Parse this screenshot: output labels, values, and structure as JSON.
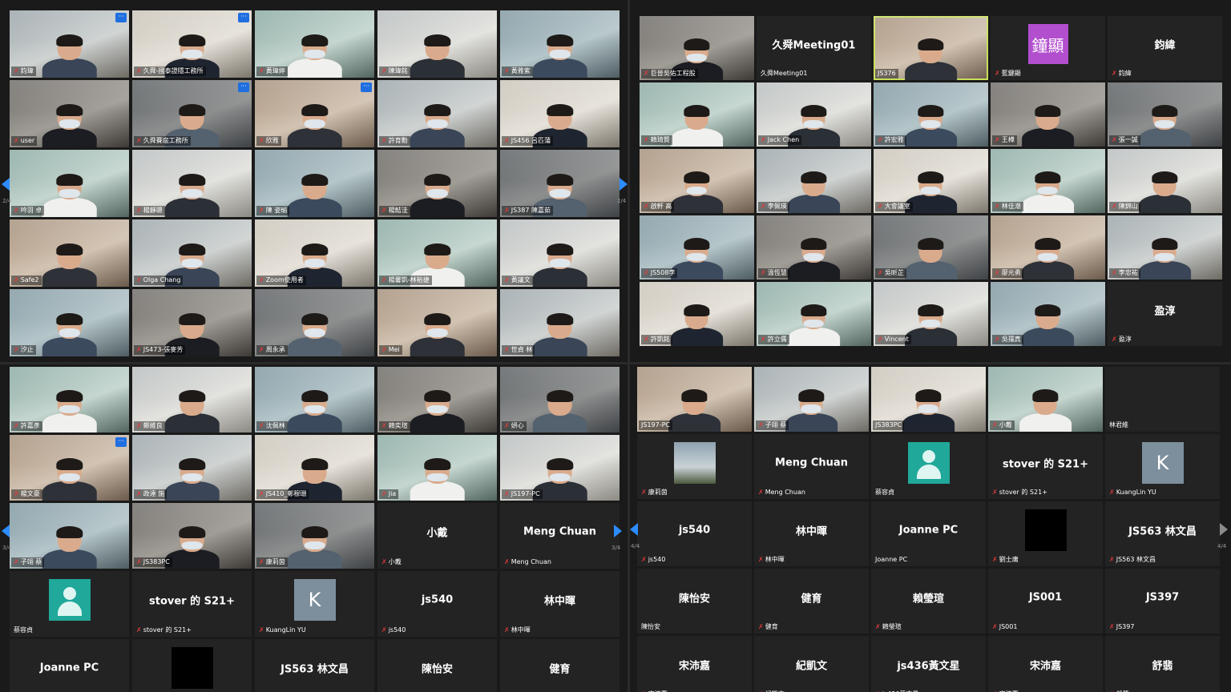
{
  "quadrants": [
    {
      "id": "top-left",
      "page": "2/4",
      "tiles": [
        {
          "name": "鈞瑋",
          "kind": "video",
          "more": true
        },
        {
          "name": "久舜-國泰證隱工務所",
          "kind": "video",
          "more": true
        },
        {
          "name": "黃瑋婷",
          "kind": "video"
        },
        {
          "name": "陳瑋銘",
          "kind": "video"
        },
        {
          "name": "黃雅紫",
          "kind": "video"
        },
        {
          "name": "user",
          "kind": "video"
        },
        {
          "name": "久舜賽扆工務所",
          "kind": "video",
          "more": true
        },
        {
          "name": "欣雅",
          "kind": "video",
          "more": true
        },
        {
          "name": "許育勳",
          "kind": "video"
        },
        {
          "name": "JS456 呂匹蒲",
          "kind": "video"
        },
        {
          "name": "吟羽 卓",
          "kind": "video"
        },
        {
          "name": "楊靜聰",
          "kind": "video"
        },
        {
          "name": "陳 姿瑜",
          "kind": "video"
        },
        {
          "name": "楊鮚洼",
          "kind": "video"
        },
        {
          "name": "JS387 陳嘉茹",
          "kind": "video"
        },
        {
          "name": "Safe2",
          "kind": "video"
        },
        {
          "name": "Olga Chang",
          "kind": "video"
        },
        {
          "name": "Zoom使用者",
          "kind": "video"
        },
        {
          "name": "楊馨凱-林裕捷",
          "kind": "video"
        },
        {
          "name": "黃議文",
          "kind": "video"
        },
        {
          "name": "汐止",
          "kind": "video"
        },
        {
          "name": "JS473-張麥芳",
          "kind": "video"
        },
        {
          "name": "周永承",
          "kind": "video"
        },
        {
          "name": "Mei",
          "kind": "video"
        },
        {
          "name": "世貞 林",
          "kind": "video"
        }
      ]
    },
    {
      "id": "top-right",
      "page": "",
      "tiles": [
        {
          "name": "巨晉吳佑工程股",
          "kind": "video"
        },
        {
          "name": "久舜Meeting01",
          "kind": "name",
          "big": "久舜Meeting01",
          "nomic": true
        },
        {
          "name": "JS376",
          "kind": "video",
          "speaking": true,
          "nomic": true
        },
        {
          "name": "藍鍵顯",
          "kind": "avatar-purple",
          "big": "鐘顯"
        },
        {
          "name": "鈞緯",
          "kind": "name",
          "big": "鈞緯"
        },
        {
          "name": "賴琦賢",
          "kind": "video"
        },
        {
          "name": "Jack Chen",
          "kind": "video"
        },
        {
          "name": "許宏雅",
          "kind": "video"
        },
        {
          "name": "王樺",
          "kind": "video"
        },
        {
          "name": "張一誠",
          "kind": "video"
        },
        {
          "name": "啟軒 高",
          "kind": "video"
        },
        {
          "name": "李佩瑛",
          "kind": "video"
        },
        {
          "name": "大會議室",
          "kind": "video"
        },
        {
          "name": "林佳潮",
          "kind": "video"
        },
        {
          "name": "陳錦山",
          "kind": "video"
        },
        {
          "name": "JS508李",
          "kind": "video"
        },
        {
          "name": "溫恆慧",
          "kind": "video"
        },
        {
          "name": "吳昕芷",
          "kind": "video"
        },
        {
          "name": "廖元勇",
          "kind": "video"
        },
        {
          "name": "李忠祐",
          "kind": "video"
        },
        {
          "name": "許凱銘",
          "kind": "video"
        },
        {
          "name": "許立儒",
          "kind": "video"
        },
        {
          "name": "Vincent",
          "kind": "video"
        },
        {
          "name": "吳孺真",
          "kind": "video"
        },
        {
          "name": "盈淳",
          "kind": "name",
          "big": "盈淳"
        }
      ]
    },
    {
      "id": "bottom-left",
      "page": "3/4",
      "tiles": [
        {
          "name": "許嘉彥",
          "kind": "video"
        },
        {
          "name": "鄭維良",
          "kind": "video"
        },
        {
          "name": "沈佩林",
          "kind": "video"
        },
        {
          "name": "賴奕瑄",
          "kind": "video"
        },
        {
          "name": "妍心",
          "kind": "video"
        },
        {
          "name": "楊文豪",
          "kind": "video",
          "more": true
        },
        {
          "name": "政達 施",
          "kind": "video"
        },
        {
          "name": "JS410_鄭穆珊",
          "kind": "video"
        },
        {
          "name": "Jia",
          "kind": "video"
        },
        {
          "name": "JS197-PC",
          "kind": "video"
        },
        {
          "name": "子翊 蔡",
          "kind": "video"
        },
        {
          "name": "JS383PC",
          "kind": "video"
        },
        {
          "name": "康莉茵",
          "kind": "video"
        },
        {
          "name": "小戴",
          "kind": "name",
          "big": "小戴"
        },
        {
          "name": "Meng Chuan",
          "kind": "name",
          "big": "Meng Chuan"
        },
        {
          "name": "蔡容貞",
          "kind": "avatar-person",
          "nomic": true
        },
        {
          "name": "stover 的 S21+",
          "kind": "name",
          "big": "stover 的 S21+"
        },
        {
          "name": "KuangLin YU",
          "kind": "avatar-letter",
          "big": "K"
        },
        {
          "name": "js540",
          "kind": "name",
          "big": "js540"
        },
        {
          "name": "林中暉",
          "kind": "name",
          "big": "林中暉"
        },
        {
          "name": "",
          "kind": "name",
          "big": "Joanne PC"
        },
        {
          "name": "",
          "kind": "avatar-black"
        },
        {
          "name": "",
          "kind": "name",
          "big": "JS563 林文昌"
        },
        {
          "name": "",
          "kind": "name",
          "big": "陳怡安"
        },
        {
          "name": "",
          "kind": "name",
          "big": "健育"
        }
      ]
    },
    {
      "id": "bottom-right",
      "page": "4/4",
      "tiles": [
        {
          "name": "JS197-PC",
          "kind": "video",
          "nomic": true
        },
        {
          "name": "子翊 蔡",
          "kind": "video"
        },
        {
          "name": "JS383PC",
          "kind": "video",
          "nomic": true
        },
        {
          "name": "小戴",
          "kind": "video"
        },
        {
          "name": "林君維",
          "kind": "name",
          "big": "",
          "nomic": true
        },
        {
          "name": "康莉茵",
          "kind": "avatar-photo"
        },
        {
          "name": "Meng Chuan",
          "kind": "name",
          "big": "Meng Chuan"
        },
        {
          "name": "蔡容貞",
          "kind": "avatar-person",
          "nomic": true
        },
        {
          "name": "stover 的 S21+",
          "kind": "name",
          "big": "stover 的 S21+"
        },
        {
          "name": "KuangLin YU",
          "kind": "avatar-letter",
          "big": "K"
        },
        {
          "name": "js540",
          "kind": "name",
          "big": "js540"
        },
        {
          "name": "林中暉",
          "kind": "name",
          "big": "林中暉"
        },
        {
          "name": "Joanne PC",
          "kind": "name",
          "big": "Joanne PC",
          "nomic": true
        },
        {
          "name": "劉士庸",
          "kind": "avatar-black"
        },
        {
          "name": "JS563 林文昌",
          "kind": "name",
          "big": "JS563 林文昌"
        },
        {
          "name": "陳怡安",
          "kind": "name",
          "big": "陳怡安",
          "nomic": true
        },
        {
          "name": "健育",
          "kind": "name",
          "big": "健育"
        },
        {
          "name": "賴瑩瑄",
          "kind": "name",
          "big": "賴瑩瑄"
        },
        {
          "name": "JS001",
          "kind": "name",
          "big": "JS001"
        },
        {
          "name": "JS397",
          "kind": "name",
          "big": "JS397"
        },
        {
          "name": "宋沛嘉",
          "kind": "name",
          "big": "宋沛嘉"
        },
        {
          "name": "紀凱文",
          "kind": "name",
          "big": "紀凱文"
        },
        {
          "name": "js436黃文星",
          "kind": "name",
          "big": "js436黃文星"
        },
        {
          "name": "宋沛嘉",
          "kind": "name",
          "big": "宋沛嘉"
        },
        {
          "name": "舒翡",
          "kind": "name",
          "big": "舒翡"
        }
      ]
    }
  ],
  "icons": {
    "muted_mic": "✗",
    "more": "···"
  },
  "colors": {
    "accent": "#2d8cff",
    "speaking": "#c8e05a",
    "muted": "#e03a3a",
    "tile_bg": "#232323",
    "window_bg": "#1a1a1a"
  }
}
